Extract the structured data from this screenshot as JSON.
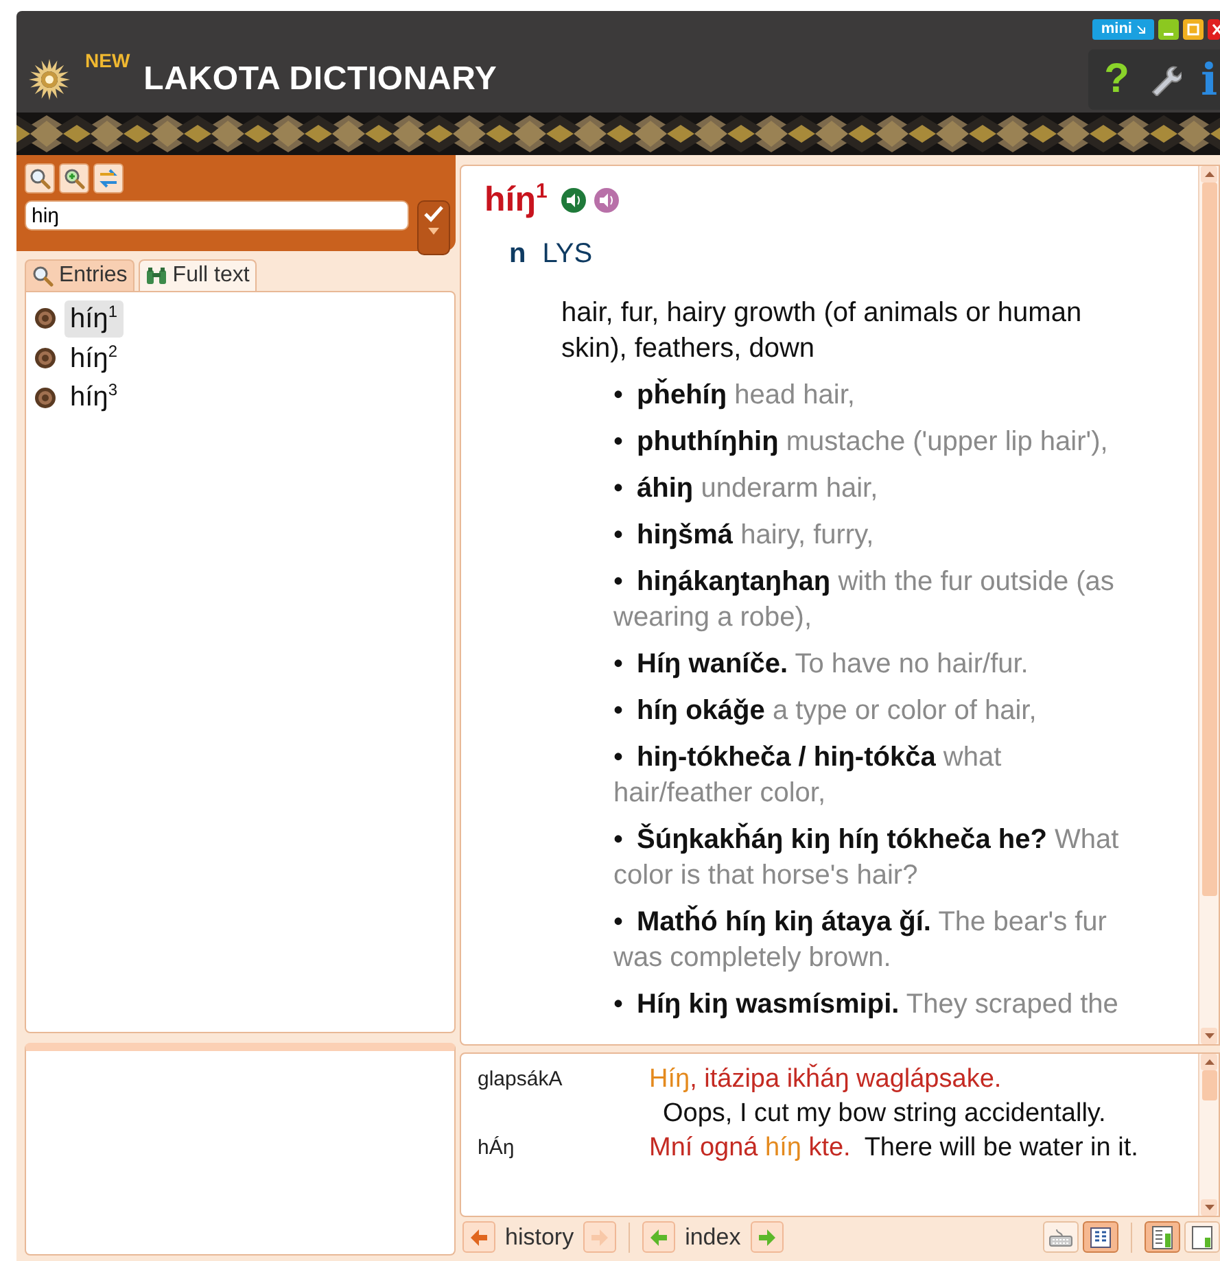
{
  "app": {
    "badge": "NEW",
    "title": "LAKOTA DICTIONARY",
    "mini_label": "mini",
    "help_glyph": "?",
    "info_glyph": "i"
  },
  "search": {
    "value": "hiŋ"
  },
  "tabs": [
    {
      "label": "Entries",
      "kind": "search",
      "selected": true
    },
    {
      "label": "Full text",
      "kind": "binoculars",
      "selected": false
    }
  ],
  "results": [
    {
      "word": "híŋ$^{1}$",
      "selected": true
    },
    {
      "word": "híŋ$^{2}$",
      "selected": false
    },
    {
      "word": "híŋ$^{3}$",
      "selected": false
    }
  ],
  "entry": {
    "headword": "híŋ$^{1}$",
    "pos": "n",
    "source": "LYS",
    "definition": "hair, fur, hairy growth (of animals or human skin), feathers, down",
    "bullet": "•",
    "examples": [
      {
        "term": "pȟehíŋ",
        "gloss": "head hair,"
      },
      {
        "term": "phuthíŋhiŋ",
        "gloss": "mustache ('upper lip hair'),"
      },
      {
        "term": "áhiŋ",
        "gloss": "underarm hair,"
      },
      {
        "term": "hiŋšmá",
        "gloss": "hairy, furry,"
      },
      {
        "term": "hiŋákaŋtaŋhaŋ",
        "gloss": "with the fur outside (as wearing a robe),"
      },
      {
        "term": "Híŋ waníče.",
        "gloss": "To have no hair/fur."
      },
      {
        "term": "híŋ okáǧe",
        "gloss": "a type or color of hair,"
      },
      {
        "term": "hiŋ-tókheča / hiŋ-tókča",
        "gloss": "what hair/feather color,"
      },
      {
        "term": "Šúŋkakȟáŋ kiŋ híŋ tókheča he?",
        "gloss": "What color is that horse's hair?"
      },
      {
        "term": "Matȟó híŋ kiŋ átaya ǧí.",
        "gloss": "The bear's fur was completely brown."
      },
      {
        "term": "Híŋ kiŋ wasmísmipi.",
        "gloss": "They scraped the"
      }
    ]
  },
  "usages": [
    {
      "key": "glapsákA",
      "sentence": [
        {
          "text": "Híŋ",
          "match": true
        },
        {
          "text": ", itázipa ikȟáŋ waglápsake.",
          "match": false
        }
      ],
      "translation": "Oops, I cut my bow string accidentally."
    },
    {
      "key": "hÁŋ",
      "sentence": [
        {
          "text": "Mní ogná ",
          "match": false
        },
        {
          "text": "híŋ",
          "match": true
        },
        {
          "text": " kte.",
          "match": false
        }
      ],
      "translation": "There will be water in it."
    }
  ],
  "nav": [
    {
      "label": "history",
      "color": "#e0661e",
      "back_disabled": false,
      "forward_disabled": true
    },
    {
      "label": "index",
      "color": "#5cb82a",
      "back_disabled": false,
      "forward_disabled": false
    }
  ],
  "view_buttons": [
    {
      "kind": "keyboard",
      "selected": false
    },
    {
      "kind": "split",
      "selected": true
    },
    {
      "kind": "layout-full",
      "selected": true
    },
    {
      "kind": "layout-half",
      "selected": false
    }
  ]
}
